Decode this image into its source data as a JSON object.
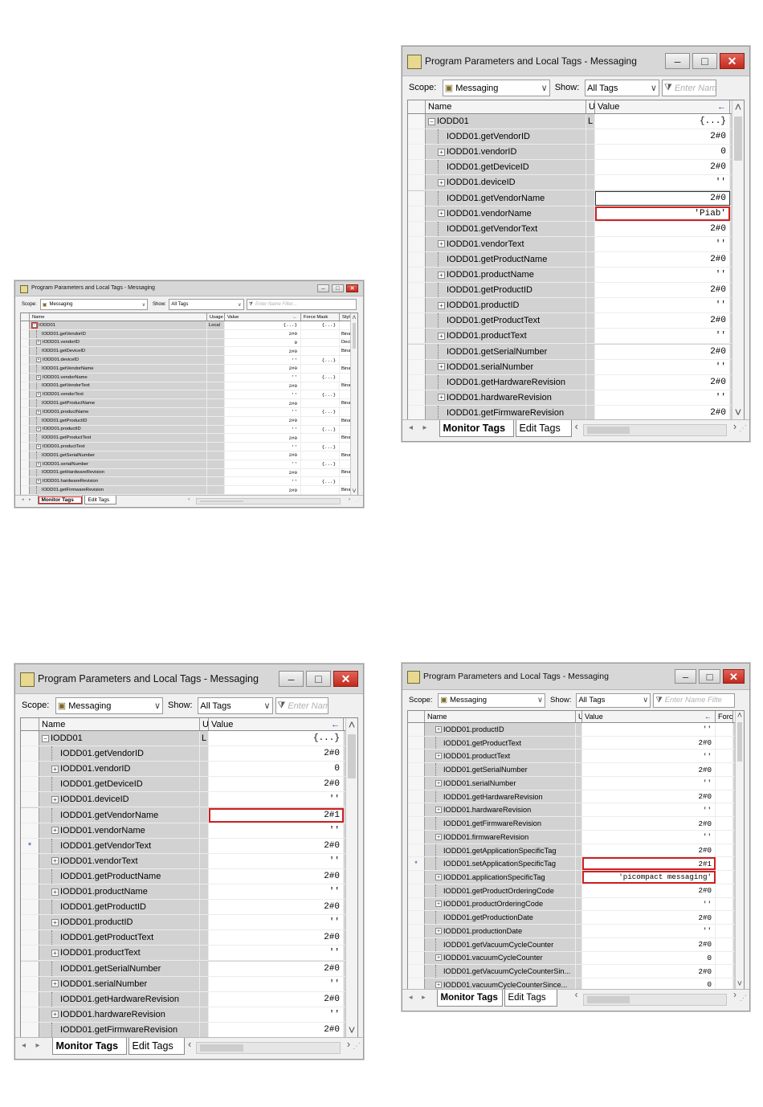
{
  "screenshots": {
    "small": {
      "title": "Program Parameters and Local Tags - Messaging",
      "scope_label": "Scope:",
      "scope_value": "Messaging",
      "show_label": "Show:",
      "show_value": "All Tags",
      "filter_placeholder": "Enter Name Filter...",
      "columns": {
        "sel": "",
        "name": "Name",
        "usage": "Usage",
        "value": "Value",
        "force": "Force Mask",
        "style": "Style"
      },
      "rows": [
        {
          "name": "IODD01",
          "usage": "Local",
          "value": "{...}",
          "force": "{...}",
          "style": "",
          "exp": "minus",
          "root": true
        },
        {
          "name": "IODD01.getVendorID",
          "usage": "",
          "value": "2#0",
          "force": "",
          "style": "Binar",
          "exp": ""
        },
        {
          "name": "IODD01.vendorID",
          "usage": "",
          "value": "0",
          "force": "",
          "style": "Decir",
          "exp": "plus"
        },
        {
          "name": "IODD01.getDeviceID",
          "usage": "",
          "value": "2#0",
          "force": "",
          "style": "Binar",
          "exp": ""
        },
        {
          "name": "IODD01.deviceID",
          "usage": "",
          "value": "''",
          "force": "{...}",
          "style": "",
          "exp": "plus"
        },
        {
          "name": "IODD01.getVendorName",
          "usage": "",
          "value": "2#0",
          "force": "",
          "style": "Binar",
          "exp": ""
        },
        {
          "name": "IODD01.vendorName",
          "usage": "",
          "value": "''",
          "force": "{...}",
          "style": "",
          "exp": "plus"
        },
        {
          "name": "IODD01.getVendorText",
          "usage": "",
          "value": "2#0",
          "force": "",
          "style": "Binar",
          "exp": ""
        },
        {
          "name": "IODD01.vendorText",
          "usage": "",
          "value": "''",
          "force": "{...}",
          "style": "",
          "exp": "plus"
        },
        {
          "name": "IODD01.getProductName",
          "usage": "",
          "value": "2#0",
          "force": "",
          "style": "Binar",
          "exp": ""
        },
        {
          "name": "IODD01.productName",
          "usage": "",
          "value": "''",
          "force": "{...}",
          "style": "",
          "exp": "plus"
        },
        {
          "name": "IODD01.getProductID",
          "usage": "",
          "value": "2#0",
          "force": "",
          "style": "Binar",
          "exp": ""
        },
        {
          "name": "IODD01.productID",
          "usage": "",
          "value": "''",
          "force": "{...}",
          "style": "",
          "exp": "plus"
        },
        {
          "name": "IODD01.getProductText",
          "usage": "",
          "value": "2#0",
          "force": "",
          "style": "Binar",
          "exp": ""
        },
        {
          "name": "IODD01.productText",
          "usage": "",
          "value": "''",
          "force": "{...}",
          "style": "",
          "exp": "plus"
        },
        {
          "name": "IODD01.getSerialNumber",
          "usage": "",
          "value": "2#0",
          "force": "",
          "style": "Binar",
          "exp": ""
        },
        {
          "name": "IODD01.serialNumber",
          "usage": "",
          "value": "''",
          "force": "{...}",
          "style": "",
          "exp": "plus"
        },
        {
          "name": "IODD01.getHardwareRevision",
          "usage": "",
          "value": "2#0",
          "force": "",
          "style": "Binar",
          "exp": ""
        },
        {
          "name": "IODD01.hardwareRevision",
          "usage": "",
          "value": "''",
          "force": "{...}",
          "style": "",
          "exp": "plus"
        },
        {
          "name": "IODD01.getFirmwareRevision",
          "usage": "",
          "value": "2#0",
          "force": "",
          "style": "Binar",
          "exp": ""
        }
      ],
      "tabs": [
        "Monitor Tags",
        "Edit Tags"
      ]
    },
    "top_right": {
      "title": "Program Parameters and Local Tags - Messaging",
      "scope_label": "Scope:",
      "scope_value": "Messaging",
      "show_label": "Show:",
      "show_value": "All Tags",
      "filter_placeholder": "Enter Nam",
      "columns": {
        "sel": "",
        "name": "Name",
        "usage": "U",
        "value": "Value"
      },
      "rows": [
        {
          "name": "IODD01",
          "usage": "L",
          "value": "{...}",
          "exp": "minus",
          "root": true
        },
        {
          "name": "IODD01.getVendorID",
          "value": "2#0",
          "exp": ""
        },
        {
          "name": "IODD01.vendorID",
          "value": "0",
          "exp": "plus"
        },
        {
          "name": "IODD01.getDeviceID",
          "value": "2#0",
          "exp": ""
        },
        {
          "name": "IODD01.deviceID",
          "value": "''",
          "exp": "plus"
        },
        {
          "name": "IODD01.getVendorName",
          "value": "2#0",
          "exp": "",
          "outline": "black"
        },
        {
          "name": "IODD01.vendorName",
          "value": "'Piab'",
          "exp": "plus",
          "outline": "red"
        },
        {
          "name": "IODD01.getVendorText",
          "value": "2#0",
          "exp": ""
        },
        {
          "name": "IODD01.vendorText",
          "value": "''",
          "exp": "plus"
        },
        {
          "name": "IODD01.getProductName",
          "value": "2#0",
          "exp": ""
        },
        {
          "name": "IODD01.productName",
          "value": "''",
          "exp": "plus"
        },
        {
          "name": "IODD01.getProductID",
          "value": "2#0",
          "exp": ""
        },
        {
          "name": "IODD01.productID",
          "value": "''",
          "exp": "plus"
        },
        {
          "name": "IODD01.getProductText",
          "value": "2#0",
          "exp": ""
        },
        {
          "name": "IODD01.productText",
          "value": "''",
          "exp": "plus"
        },
        {
          "name": "IODD01.getSerialNumber",
          "value": "2#0",
          "exp": ""
        },
        {
          "name": "IODD01.serialNumber",
          "value": "''",
          "exp": "plus"
        },
        {
          "name": "IODD01.getHardwareRevision",
          "value": "2#0",
          "exp": ""
        },
        {
          "name": "IODD01.hardwareRevision",
          "value": "''",
          "exp": "plus"
        },
        {
          "name": "IODD01.getFirmwareRevision",
          "value": "2#0",
          "exp": ""
        }
      ],
      "tabs": [
        "Monitor Tags",
        "Edit Tags"
      ]
    },
    "bottom_left": {
      "title": "Program Parameters and Local Tags - Messaging",
      "scope_label": "Scope:",
      "scope_value": "Messaging",
      "show_label": "Show:",
      "show_value": "All Tags",
      "filter_placeholder": "Enter Nam",
      "columns": {
        "sel": "",
        "name": "Name",
        "usage": "U",
        "value": "Value"
      },
      "rows": [
        {
          "name": "IODD01",
          "usage": "L",
          "value": "{...}",
          "exp": "minus",
          "root": true
        },
        {
          "name": "IODD01.getVendorID",
          "value": "2#0",
          "exp": ""
        },
        {
          "name": "IODD01.vendorID",
          "value": "0",
          "exp": "plus"
        },
        {
          "name": "IODD01.getDeviceID",
          "value": "2#0",
          "exp": ""
        },
        {
          "name": "IODD01.deviceID",
          "value": "''",
          "exp": "plus"
        },
        {
          "name": "IODD01.getVendorName",
          "value": "2#1",
          "exp": "",
          "outline": "red"
        },
        {
          "name": "IODD01.vendorName",
          "value": "''",
          "exp": "plus"
        },
        {
          "name": "IODD01.getVendorText",
          "value": "2#0",
          "exp": "",
          "marker": "*"
        },
        {
          "name": "IODD01.vendorText",
          "value": "''",
          "exp": "plus"
        },
        {
          "name": "IODD01.getProductName",
          "value": "2#0",
          "exp": ""
        },
        {
          "name": "IODD01.productName",
          "value": "''",
          "exp": "plus"
        },
        {
          "name": "IODD01.getProductID",
          "value": "2#0",
          "exp": ""
        },
        {
          "name": "IODD01.productID",
          "value": "''",
          "exp": "plus"
        },
        {
          "name": "IODD01.getProductText",
          "value": "2#0",
          "exp": ""
        },
        {
          "name": "IODD01.productText",
          "value": "''",
          "exp": "plus"
        },
        {
          "name": "IODD01.getSerialNumber",
          "value": "2#0",
          "exp": ""
        },
        {
          "name": "IODD01.serialNumber",
          "value": "''",
          "exp": "plus"
        },
        {
          "name": "IODD01.getHardwareRevision",
          "value": "2#0",
          "exp": ""
        },
        {
          "name": "IODD01.hardwareRevision",
          "value": "''",
          "exp": "plus"
        },
        {
          "name": "IODD01.getFirmwareRevision",
          "value": "2#0",
          "exp": ""
        }
      ],
      "tabs": [
        "Monitor Tags",
        "Edit Tags"
      ]
    },
    "bottom_right": {
      "title": "Program Parameters and Local Tags - Messaging",
      "scope_label": "Scope:",
      "scope_value": "Messaging",
      "show_label": "Show:",
      "show_value": "All Tags",
      "filter_placeholder": "Enter Name Filte",
      "columns": {
        "sel": "",
        "name": "Name",
        "usage": "U",
        "value": "Value",
        "force": "Forc"
      },
      "rows": [
        {
          "name": "IODD01.productID",
          "value": "''",
          "exp": "plus"
        },
        {
          "name": "IODD01.getProductText",
          "value": "2#0",
          "exp": ""
        },
        {
          "name": "IODD01.productText",
          "value": "''",
          "exp": "plus"
        },
        {
          "name": "IODD01.getSerialNumber",
          "value": "2#0",
          "exp": ""
        },
        {
          "name": "IODD01.serialNumber",
          "value": "''",
          "exp": "plus"
        },
        {
          "name": "IODD01.getHardwareRevision",
          "value": "2#0",
          "exp": ""
        },
        {
          "name": "IODD01.hardwareRevision",
          "value": "''",
          "exp": "plus"
        },
        {
          "name": "IODD01.getFirmwareRevision",
          "value": "2#0",
          "exp": ""
        },
        {
          "name": "IODD01.firmwareRevision",
          "value": "''",
          "exp": "plus"
        },
        {
          "name": "IODD01.getApplicationSpecificTag",
          "value": "2#0",
          "exp": ""
        },
        {
          "name": "IODD01.setApplicationSpecificTag",
          "value": "2#1",
          "exp": "",
          "outline": "red",
          "marker": "*"
        },
        {
          "name": "IODD01.applicationSpecificTag",
          "value": "'picompact messaging'",
          "exp": "plus",
          "outline": "red"
        },
        {
          "name": "IODD01.getProductOrderingCode",
          "value": "2#0",
          "exp": ""
        },
        {
          "name": "IODD01.productOrderingCode",
          "value": "''",
          "exp": "plus"
        },
        {
          "name": "IODD01.getProductionDate",
          "value": "2#0",
          "exp": ""
        },
        {
          "name": "IODD01.productionDate",
          "value": "''",
          "exp": "plus"
        },
        {
          "name": "IODD01.getVacuumCycleCounter",
          "value": "2#0",
          "exp": ""
        },
        {
          "name": "IODD01.vacuumCycleCounter",
          "value": "0",
          "exp": "plus"
        },
        {
          "name": "IODD01.getVacuumCycleCounterSin...",
          "value": "2#0",
          "exp": ""
        },
        {
          "name": "IODD01.vacuumCycleCounterSince...",
          "value": "0",
          "exp": "plus"
        }
      ],
      "tabs": [
        "Monitor Tags",
        "Edit Tags"
      ]
    }
  }
}
